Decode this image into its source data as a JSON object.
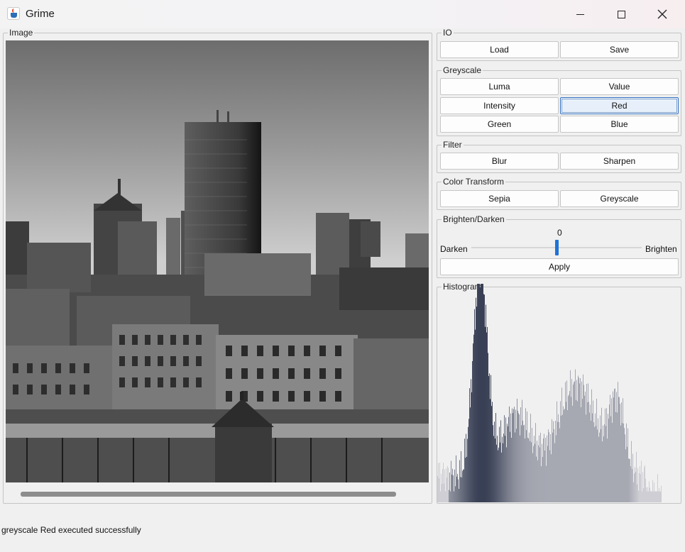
{
  "window": {
    "title": "Grime",
    "icon": "java-cup-icon",
    "controls": [
      "minimize-icon",
      "maximize-icon",
      "close-icon"
    ]
  },
  "image_panel": {
    "title": "Image",
    "content": "greyscale city skyline photograph"
  },
  "io": {
    "title": "IO",
    "load_label": "Load",
    "save_label": "Save"
  },
  "greyscale": {
    "title": "Greyscale",
    "luma_label": "Luma",
    "value_label": "Value",
    "intensity_label": "Intensity",
    "red_label": "Red",
    "green_label": "Green",
    "blue_label": "Blue",
    "focused": "Red"
  },
  "filter": {
    "title": "Filter",
    "blur_label": "Blur",
    "sharpen_label": "Sharpen"
  },
  "color_transform": {
    "title": "Color Transform",
    "sepia_label": "Sepia",
    "greyscale_label": "Greyscale"
  },
  "brighten": {
    "title": "Brighten/Darken",
    "value": "0",
    "darken_label": "Darken",
    "brighten_label": "Brighten",
    "apply_label": "Apply",
    "slider_fraction": 0.5
  },
  "histogram": {
    "title": "Histogram",
    "colors": {
      "dark": "#06102a",
      "light": "#e6e6e6",
      "mid": "#2a3e5e"
    }
  },
  "status": {
    "message": "greyscale Red executed successfully"
  }
}
